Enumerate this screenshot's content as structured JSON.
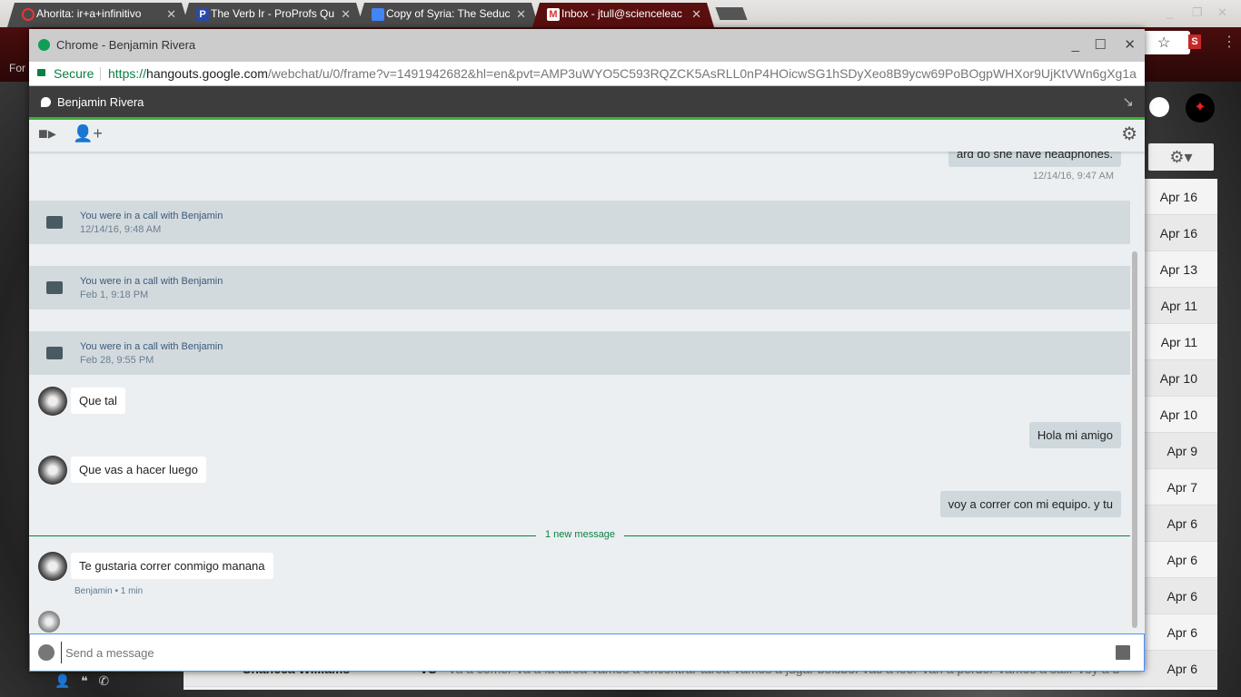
{
  "tabs": [
    {
      "label": "Ahorita: ir+a+infinitivo",
      "icon": "ring-icon"
    },
    {
      "label": "The Verb Ir - ProProfs Qu",
      "icon": "proprofs-icon"
    },
    {
      "label": "Copy of Syria: The Seduc",
      "icon": "docs-icon"
    },
    {
      "label": "Inbox - jtull@scienceleac",
      "icon": "gmail-icon",
      "active": true
    }
  ],
  "bookmark_fragment": "For",
  "popup": {
    "title": "Chrome - Benjamin Rivera",
    "secure": "Secure",
    "url_scheme": "https://",
    "url_host": "hangouts.google.com",
    "url_path": "/webchat/u/0/frame?v=1491942682&hl=en&pvt=AMP3uWYO5C593RQZCK5AsRLL0nP4HOicwSG1hSDyXeo8B9ycw69PoBOgpWHXor9UjKtVWn6gXg1a"
  },
  "chat": {
    "contact": "Benjamin Rivera",
    "cut_message": "ard do she have headphones.",
    "cut_time": "12/14/16, 9:47 AM",
    "calls": [
      {
        "text": "You were in a call with Benjamin",
        "time": "12/14/16, 9:48 AM"
      },
      {
        "text": "You were in a call with Benjamin",
        "time": "Feb 1, 9:18 PM"
      },
      {
        "text": "You were in a call with Benjamin",
        "time": "Feb 28, 9:55 PM"
      }
    ],
    "messages": [
      {
        "dir": "in",
        "text": "Que tal"
      },
      {
        "dir": "out",
        "text": "Hola mi amigo"
      },
      {
        "dir": "in",
        "text": "Que vas a hacer luego"
      },
      {
        "dir": "out",
        "text": "voy a correr con mi equipo. y tu"
      },
      {
        "dir": "in",
        "text": "Te gustaria correr conmigo manana"
      }
    ],
    "new_message": "1 new message",
    "last_meta": "Benjamin • 1 min",
    "input_placeholder": "Send a message",
    "accent": "#3cb034"
  },
  "gmail": {
    "dates": [
      "Apr 16",
      "Apr 16",
      "Apr 13",
      "Apr 11",
      "Apr 11",
      "Apr 10",
      "Apr 10",
      "Apr 9",
      "Apr 7",
      "Apr 6",
      "Apr 6",
      "Apr 6",
      "Apr 6",
      "Apr 6"
    ],
    "last_row": {
      "sender": "Shaneea Williams",
      "subject": "VS",
      "snippet": "Va a comer Va a la tarea Vamos a encontrar tarea Vamos a jugar beisbol Vas a leer Van a perder Vamos a salir Voy a de com"
    }
  }
}
